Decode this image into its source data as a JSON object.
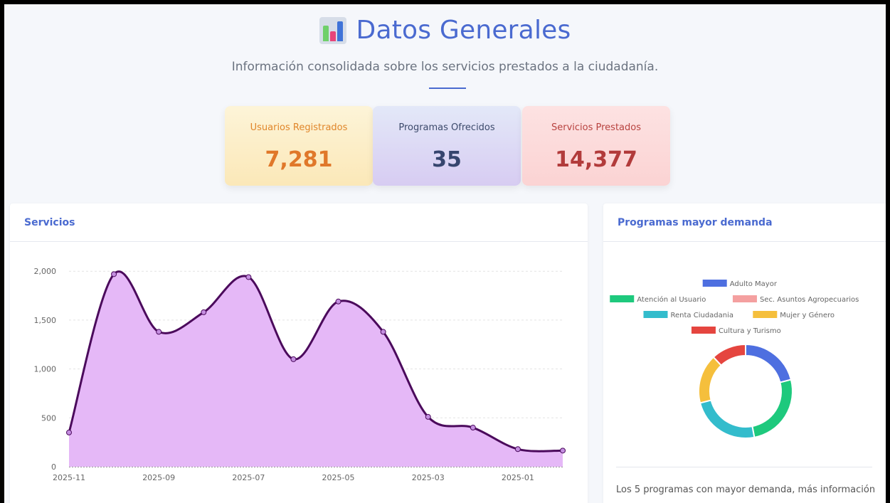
{
  "header": {
    "title": "Datos Generales",
    "subtitle": "Información consolidada sobre los servicios prestados a la ciudadanía.",
    "icon": "bar-chart-icon"
  },
  "stats": {
    "users": {
      "label": "Usuarios Registrados",
      "value": "7,281"
    },
    "programs": {
      "label": "Programas Ofrecidos",
      "value": "35"
    },
    "services": {
      "label": "Servicios Prestados",
      "value": "14,377"
    }
  },
  "services_panel": {
    "title": "Servicios"
  },
  "programs_panel": {
    "title": "Programas mayor demanda",
    "footer": "Los 5 programas con mayor demanda, más información"
  },
  "chart_data": [
    {
      "type": "area",
      "title": "Servicios",
      "x": [
        "2025-11",
        "2025-10",
        "2025-09",
        "2025-08",
        "2025-07",
        "2025-06",
        "2025-05",
        "2025-04",
        "2025-03",
        "2025-02",
        "2025-01",
        "2024-12"
      ],
      "x_tick_labels": [
        "2025-11",
        "2025-09",
        "2025-07",
        "2025-05",
        "2025-03",
        "2025-01"
      ],
      "values": [
        350,
        1970,
        1380,
        1580,
        1940,
        1100,
        1690,
        1380,
        510,
        400,
        180,
        165
      ],
      "ylim": [
        0,
        2300
      ],
      "yticks": [
        "0",
        "500",
        "1,000",
        "1,500",
        "2,000"
      ],
      "grid": true,
      "colors": {
        "line": "#4b0a5c",
        "fill": "#e5b8f7",
        "point": "#c48ee0"
      }
    },
    {
      "type": "pie",
      "title": "Programas mayor demanda",
      "labels": [
        "Adulto Mayor",
        "Atención al Usuario",
        "Sec. Asuntos Agropecuarios",
        "Renta Ciudadania",
        "Mujer y Género",
        "Cultura y Turismo"
      ],
      "values": [
        21,
        26,
        0,
        24,
        17,
        12
      ],
      "colors": [
        "#4e6fe0",
        "#1ec97d",
        "#f4a0a0",
        "#33bccc",
        "#f5bf3c",
        "#e5453f"
      ],
      "legend": "top",
      "donut": true
    }
  ]
}
